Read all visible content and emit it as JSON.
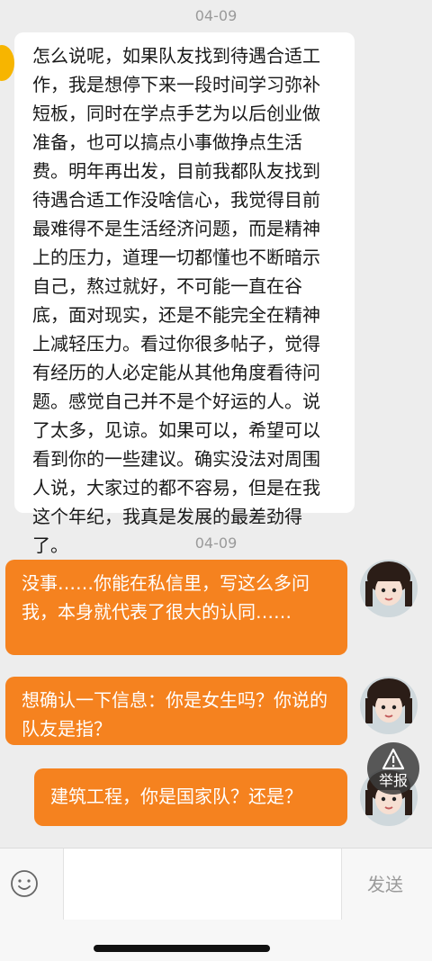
{
  "timestamps": [
    "04-09",
    "04-09"
  ],
  "messages": {
    "incoming_1": "怎么说呢，如果队友找到待遇合适工作，我是想停下来一段时间学习弥补短板，同时在学点手艺为以后创业做准备，也可以搞点小事做挣点生活费。明年再出发，目前我都队友找到待遇合适工作没啥信心，我觉得目前最难得不是生活经济问题，而是精神上的压力，道理一切都懂也不断暗示自己，熬过就好，不可能一直在谷底，面对现实，还是不能完全在精神上减轻压力。看过你很多帖子，觉得有经历的人必定能从其他角度看待问题。感觉自己并不是个好运的人。说了太多，见谅。如果可以，希望可以看到你的一些建议。确实没法对周围人说，大家过的都不容易，但是在我这个年纪，我真是发展的最差劲得了。",
    "outgoing_1": "没事……你能在私信里，写这么多问我，本身就代表了很大的认同……",
    "outgoing_2": "想确认一下信息：你是女生吗？你说的队友是指？",
    "outgoing_3": "建筑工程，你是国家队？还是？"
  },
  "report_button": {
    "label": "举报",
    "icon": "warning-icon"
  },
  "input_bar": {
    "emoji_icon": "emoji-icon",
    "input_value": "",
    "send_label": "发送"
  },
  "colors": {
    "background": "#ededed",
    "outgoing_bubble": "#f5821f",
    "incoming_bubble": "#ffffff",
    "send_text": "#9a9a9a"
  }
}
